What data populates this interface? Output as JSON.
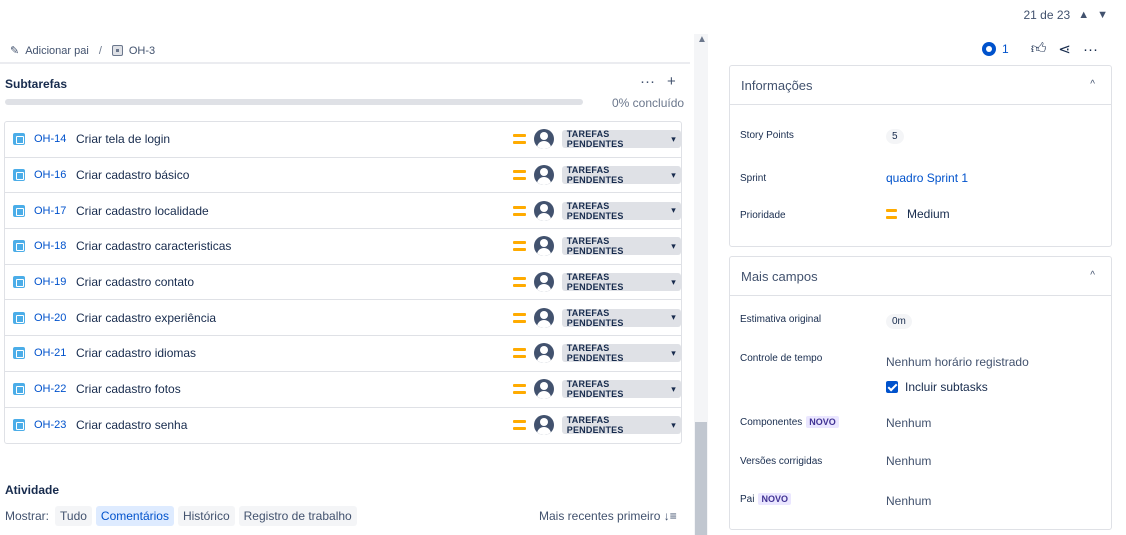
{
  "pager": {
    "text": "21 de 23",
    "prev_icon": "chevron-up-icon",
    "next_icon": "chevron-down-icon"
  },
  "breadcrumb": {
    "add_parent": "Adicionar pai",
    "separator": "/",
    "issue_key": "OH-3"
  },
  "subtasks": {
    "title": "Subtarefas",
    "more_label": "···",
    "add_label": "+",
    "progress_label": "0% concluído",
    "progress_fraction": 0,
    "items": [
      {
        "key": "OH-14",
        "summary": "Criar tela de login",
        "status": "TAREFAS PENDENTES"
      },
      {
        "key": "OH-16",
        "summary": "Criar cadastro básico",
        "status": "TAREFAS PENDENTES"
      },
      {
        "key": "OH-17",
        "summary": "Criar cadastro localidade",
        "status": "TAREFAS PENDENTES"
      },
      {
        "key": "OH-18",
        "summary": "Criar cadastro caracteristicas",
        "status": "TAREFAS PENDENTES"
      },
      {
        "key": "OH-19",
        "summary": "Criar cadastro contato",
        "status": "TAREFAS PENDENTES"
      },
      {
        "key": "OH-20",
        "summary": "Criar cadastro experiência",
        "status": "TAREFAS PENDENTES"
      },
      {
        "key": "OH-21",
        "summary": "Criar cadastro idiomas",
        "status": "TAREFAS PENDENTES"
      },
      {
        "key": "OH-22",
        "summary": "Criar cadastro fotos",
        "status": "TAREFAS PENDENTES"
      },
      {
        "key": "OH-23",
        "summary": "Criar cadastro senha",
        "status": "TAREFAS PENDENTES"
      }
    ]
  },
  "activity": {
    "title": "Atividade",
    "show_label": "Mostrar:",
    "filters": [
      "Tudo",
      "Comentários",
      "Histórico",
      "Registro de trabalho"
    ],
    "active_filter": "Comentários",
    "sort_label": "Mais recentes primeiro ↓≡"
  },
  "header_actions": {
    "watchers_count": "1",
    "like_icon": "thumbs-up-icon",
    "share_icon": "share-icon",
    "more_icon": "more-icon"
  },
  "info_panel": {
    "title": "Informações",
    "story_points_label": "Story Points",
    "story_points_value": "5",
    "sprint_label": "Sprint",
    "sprint_value": "quadro Sprint 1",
    "priority_label": "Prioridade",
    "priority_value": "Medium"
  },
  "more_fields_panel": {
    "title": "Mais campos",
    "estimate_label": "Estimativa original",
    "estimate_value": "0m",
    "time_tracking_label": "Controle de tempo",
    "time_tracking_value": "Nenhum horário registrado",
    "include_subtasks_label": "Incluir subtasks",
    "components_label": "Componentes",
    "new_badge": "NOVO",
    "components_value": "Nenhum",
    "fix_versions_label": "Versões corrigidas",
    "fix_versions_value": "Nenhum",
    "parent_label": "Pai",
    "parent_value": "Nenhum"
  },
  "colors": {
    "accent": "#0052cc",
    "priority_medium": "#ffab00",
    "story_icon": "#4bade8",
    "status_bg": "#dfe1e6"
  }
}
